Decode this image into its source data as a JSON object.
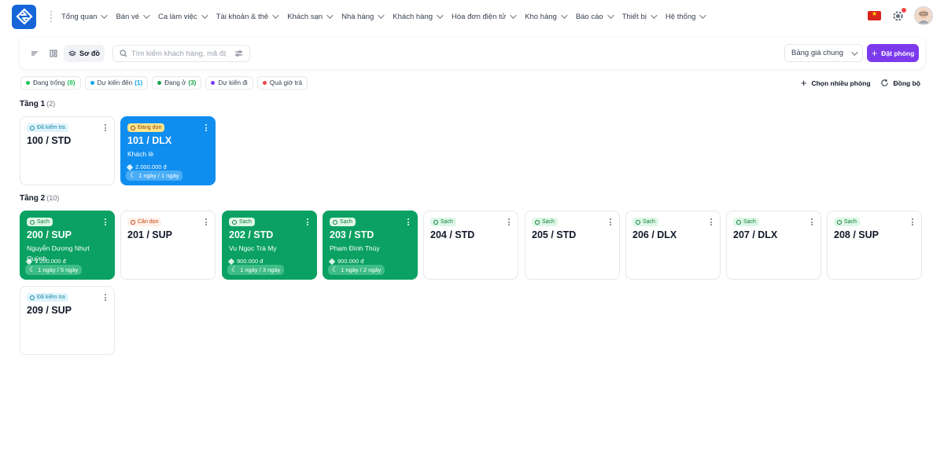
{
  "nav": {
    "menu": [
      "Tổng quan",
      "Bán vé",
      "Ca làm việc",
      "Tài khoản & thẻ",
      "Khách sạn",
      "Nhà hàng",
      "Khách hàng",
      "Hóa đơn điện tử",
      "Kho hàng",
      "Báo cáo",
      "Thiết bị",
      "Hệ thống"
    ]
  },
  "toolbar": {
    "view_map_label": "Sơ đồ",
    "search_placeholder": "Tìm kiếm khách hàng, mã đặt phòng",
    "price_list": "Bảng giá chung",
    "book_label": "Đặt phòng"
  },
  "legend": [
    {
      "label": "Đang trống",
      "count": "(8)",
      "color": "#22c55e"
    },
    {
      "label": "Dự kiến đến",
      "count": "(1)",
      "color": "#0ea5e9"
    },
    {
      "label": "Đang ở",
      "count": "(3)",
      "color": "#16a34a"
    },
    {
      "label": "Dự kiến đi",
      "count": "",
      "color": "#7c3aed"
    },
    {
      "label": "Quá giờ trả",
      "count": "",
      "color": "#ef4444"
    }
  ],
  "actions": {
    "select_multiple": "Chọn nhiều phòng",
    "sync": "Đồng bộ"
  },
  "floors": [
    {
      "name": "Tầng 1",
      "count": "(2)",
      "rooms": [
        {
          "status": "Đã kiểm tra",
          "status_type": "checked",
          "number": "100 / STD",
          "style": "white"
        },
        {
          "status": "Đang dọn",
          "status_type": "cleaning",
          "number": "101 / DLX",
          "style": "blue",
          "guest": "Khách lẻ",
          "price": "2.000.000 đ",
          "stay": "1 ngày / 1 ngày"
        }
      ]
    },
    {
      "name": "Tầng 2",
      "count": "(10)",
      "rooms": [
        {
          "status": "Sạch",
          "status_type": "clean",
          "number": "200 / SUP",
          "style": "green",
          "guest": "Nguyễn Dương Nhựt Quỳnh",
          "price": "1.200.000 đ",
          "stay": "1 ngày / 5 ngày"
        },
        {
          "status": "Cần dọn",
          "status_type": "dirty",
          "number": "201 / SUP",
          "style": "white"
        },
        {
          "status": "Sạch",
          "status_type": "clean",
          "number": "202 / STD",
          "style": "green",
          "guest": "Vu Ngọc Trà My",
          "price": "900.000 đ",
          "stay": "1 ngày / 3 ngày"
        },
        {
          "status": "Sạch",
          "status_type": "clean",
          "number": "203 / STD",
          "style": "green",
          "guest": "Phạm Đình Thùy",
          "price": "900.000 đ",
          "stay": "1 ngày / 2 ngày"
        },
        {
          "status": "Sạch",
          "status_type": "clean",
          "number": "204 / STD",
          "style": "white"
        },
        {
          "status": "Sạch",
          "status_type": "clean",
          "number": "205 / STD",
          "style": "white"
        },
        {
          "status": "Sạch",
          "status_type": "clean",
          "number": "206 / DLX",
          "style": "white"
        },
        {
          "status": "Sạch",
          "status_type": "clean",
          "number": "207 / DLX",
          "style": "white"
        },
        {
          "status": "Sạch",
          "status_type": "clean",
          "number": "208 / SUP",
          "style": "white"
        },
        {
          "status": "Đã kiểm tra",
          "status_type": "checked",
          "number": "209 / SUP",
          "style": "white"
        }
      ]
    }
  ]
}
